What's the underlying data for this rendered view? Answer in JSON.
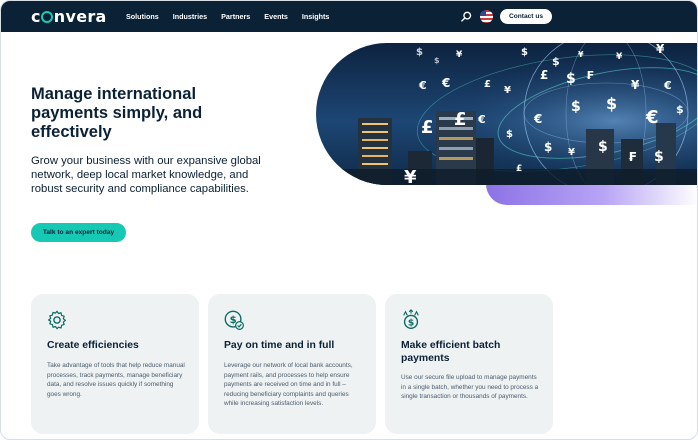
{
  "nav": {
    "logo": "convera",
    "links": [
      "Solutions",
      "Industries",
      "Partners",
      "Events",
      "Insights"
    ],
    "contact_label": "Contact us",
    "icons": {
      "search": "search-icon",
      "region": "us-flag-icon"
    }
  },
  "hero": {
    "title": "Manage international payments simply, and effectively",
    "subtitle": "Grow your business with our expansive global network, deep local market knowledge, and robust security and compliance capabilities.",
    "cta_label": "Talk to an expert today",
    "currency_symbols": [
      "$",
      "£",
      "€",
      "¥",
      "₣",
      "₿"
    ]
  },
  "cards": [
    {
      "icon": "gear-icon",
      "title": "Create efficiencies",
      "body": "Take advantage of tools that help reduce manual processes, track payments, manage beneficiary data, and resolve issues quickly if something goes wrong."
    },
    {
      "icon": "dollar-check-icon",
      "title": "Pay on time and in full",
      "body": "Leverage our network of local bank accounts, payment rails, and processes to help ensure payments are received on time and in full – reducing beneficiary complaints and queries while increasing satisfaction levels."
    },
    {
      "icon": "batch-payment-icon",
      "title": "Make efficient batch payments",
      "body": "Use our secure file upload to manage payments in a single batch, whether you need to process a single transaction or thousands of payments."
    }
  ],
  "colors": {
    "navy": "#0b2136",
    "teal": "#16c9b5",
    "purple": "#8c72e6",
    "card_bg": "#eef2f3"
  }
}
